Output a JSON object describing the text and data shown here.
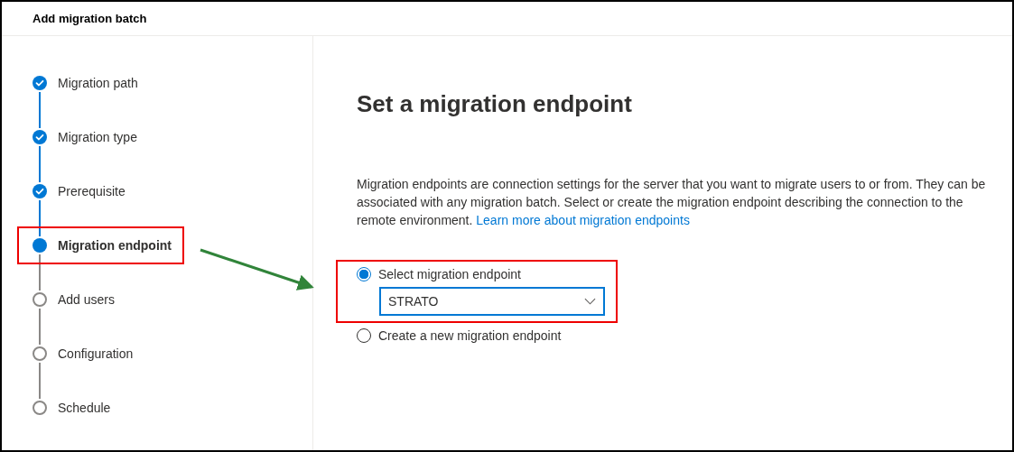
{
  "dialog": {
    "title": "Add migration batch"
  },
  "steps": [
    {
      "label": "Migration path",
      "kind": "done",
      "highlighted": false
    },
    {
      "label": "Migration type",
      "kind": "done",
      "highlighted": false
    },
    {
      "label": "Prerequisite",
      "kind": "done",
      "highlighted": false
    },
    {
      "label": "Migration endpoint",
      "kind": "current",
      "highlighted": true
    },
    {
      "label": "Add users",
      "kind": "todo",
      "highlighted": false
    },
    {
      "label": "Configuration",
      "kind": "todo",
      "highlighted": false
    },
    {
      "label": "Schedule",
      "kind": "todo",
      "highlighted": false
    }
  ],
  "content": {
    "heading": "Set a migration endpoint",
    "description": "Migration endpoints are connection settings for the server that you want to migrate users to or from. They can be associated with any migration batch. Select or create the migration endpoint describing the connection to the remote environment.",
    "link": "Learn more about migration endpoints",
    "options_highlighted": true,
    "options": [
      {
        "label": "Select migration endpoint",
        "selected": true,
        "dropdown": {
          "value": "STRATO"
        }
      },
      {
        "label": "Create a new migration endpoint",
        "selected": false
      }
    ]
  }
}
